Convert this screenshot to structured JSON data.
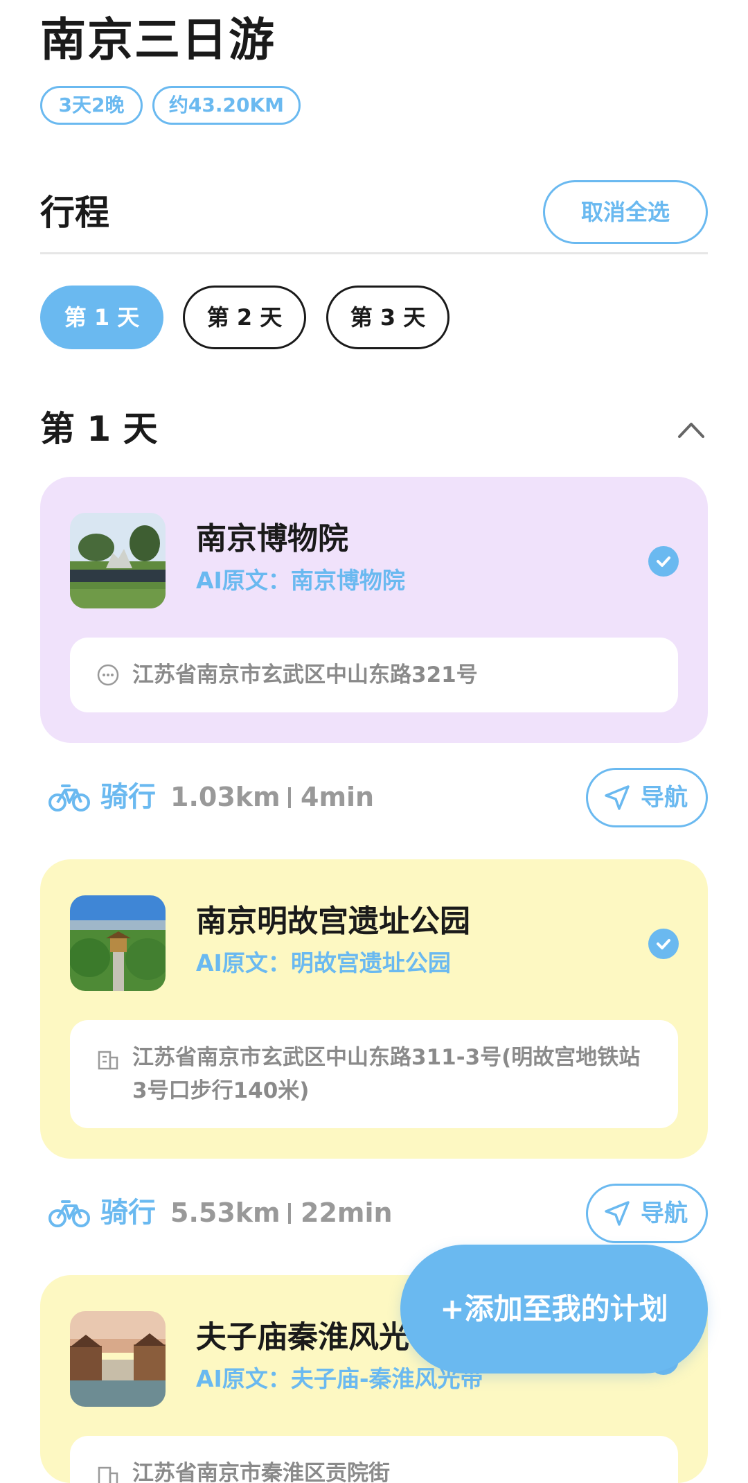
{
  "header": {
    "title": "南京三日游",
    "tags": [
      "3天2晚",
      "约43.20KM"
    ]
  },
  "itinerary": {
    "section_title": "行程",
    "deselect_label": "取消全选",
    "day_tabs": [
      "第 1 天",
      "第 2 天",
      "第 3 天"
    ],
    "active_day": "第 1 天",
    "day_heading": "第 1 天"
  },
  "places": [
    {
      "name": "南京博物院",
      "ai_text": "AI原文：南京博物院",
      "address": "江苏省南京市玄武区中山东路321号",
      "selected": true,
      "bg": "#f0e2fb"
    },
    {
      "name": "南京明故宫遗址公园",
      "ai_text": "AI原文：明故宫遗址公园",
      "address": "江苏省南京市玄武区中山东路311-3号(明故宫地铁站3号口步行140米)",
      "selected": true,
      "bg": "#fdf8c2"
    },
    {
      "name": "夫子庙秦淮风光",
      "ai_text": "AI原文：夫子庙-秦淮风光带",
      "address": "江苏省南京市秦淮区贡院街",
      "selected": true,
      "bg": "#fdf8c2"
    }
  ],
  "routes": [
    {
      "mode": "骑行",
      "distance": "1.03km",
      "duration": "4min",
      "nav_label": "导航"
    },
    {
      "mode": "骑行",
      "distance": "5.53km",
      "duration": "22min",
      "nav_label": "导航"
    }
  ],
  "fab_label": "+添加至我的计划",
  "colors": {
    "accent": "#6ab9f0",
    "card_purple": "#f0e2fb",
    "card_yellow": "#fdf8c2"
  },
  "icons": [
    "chevron-up-icon",
    "check-icon",
    "location-dots-icon",
    "building-icon",
    "bike-icon",
    "navigation-arrow-icon"
  ]
}
